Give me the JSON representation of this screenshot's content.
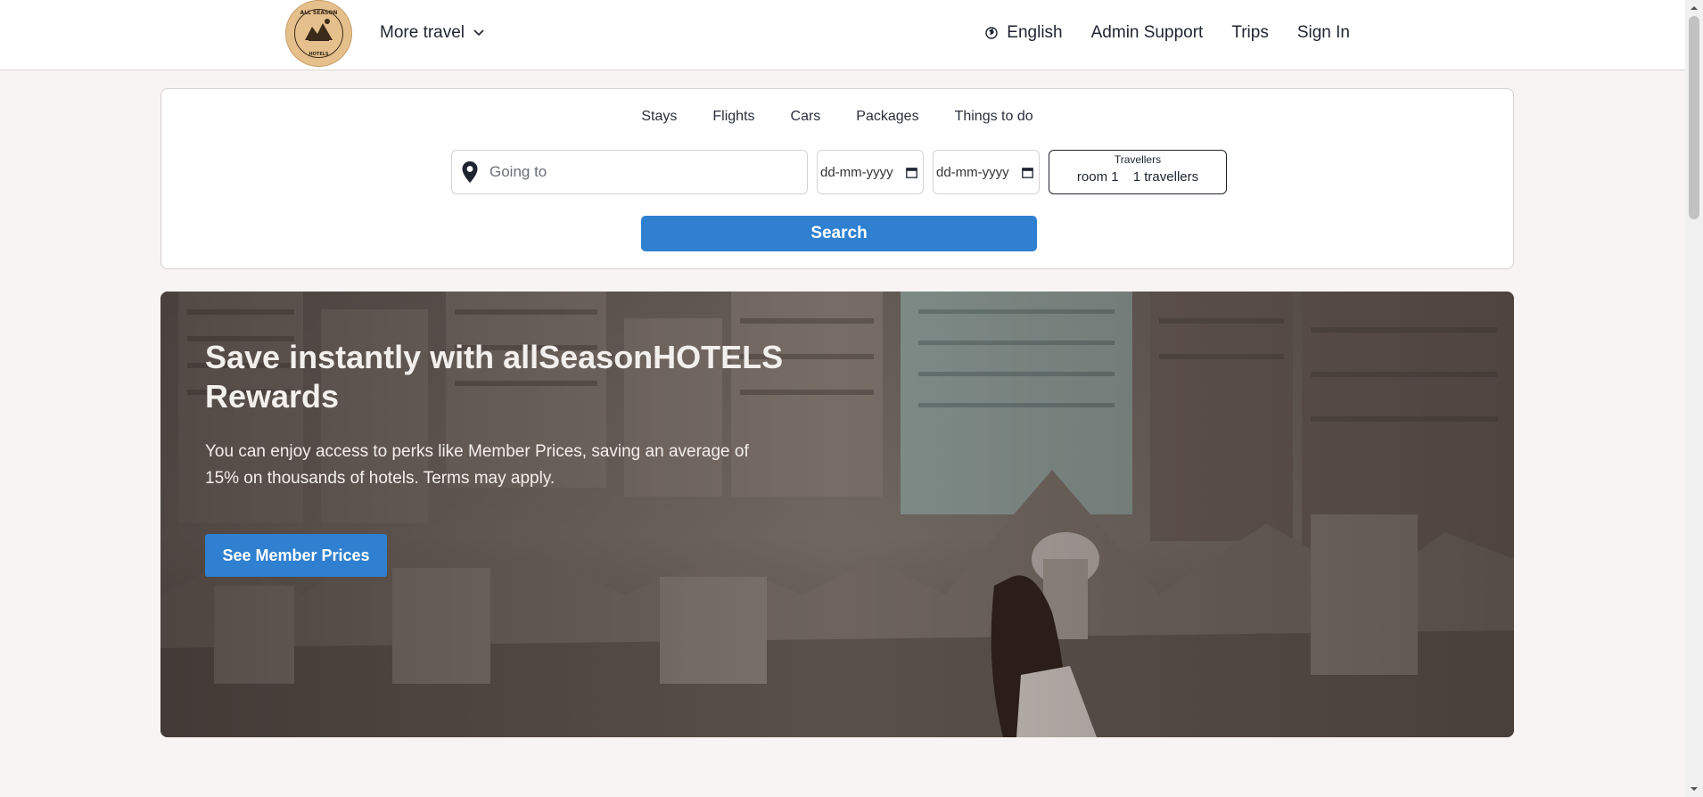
{
  "header": {
    "logo_alt": "All Season Hotels",
    "more_travel_label": "More travel",
    "language_label": "English",
    "admin_support_label": "Admin Support",
    "trips_label": "Trips",
    "sign_in_label": "Sign In"
  },
  "search": {
    "tabs": [
      "Stays",
      "Flights",
      "Cars",
      "Packages",
      "Things to do"
    ],
    "going_to_placeholder": "Going to",
    "checkin_placeholder": "dd-mm-yyyy",
    "checkout_placeholder": "dd-mm-yyyy",
    "travellers_label": "Travellers",
    "rooms_value": "room 1",
    "travellers_value": "1 travellers",
    "search_button_label": "Search"
  },
  "hero": {
    "title": "Save instantly with allSeasonHOTELS Rewards",
    "body": "You can enjoy access to perks like Member Prices, saving an average of 15% on thousands of hotels. Terms may apply.",
    "button_label": "See Member Prices"
  },
  "colors": {
    "accent": "#2f80d0",
    "page_background": "#f7f4f3",
    "logo_background": "#e5c08d"
  }
}
